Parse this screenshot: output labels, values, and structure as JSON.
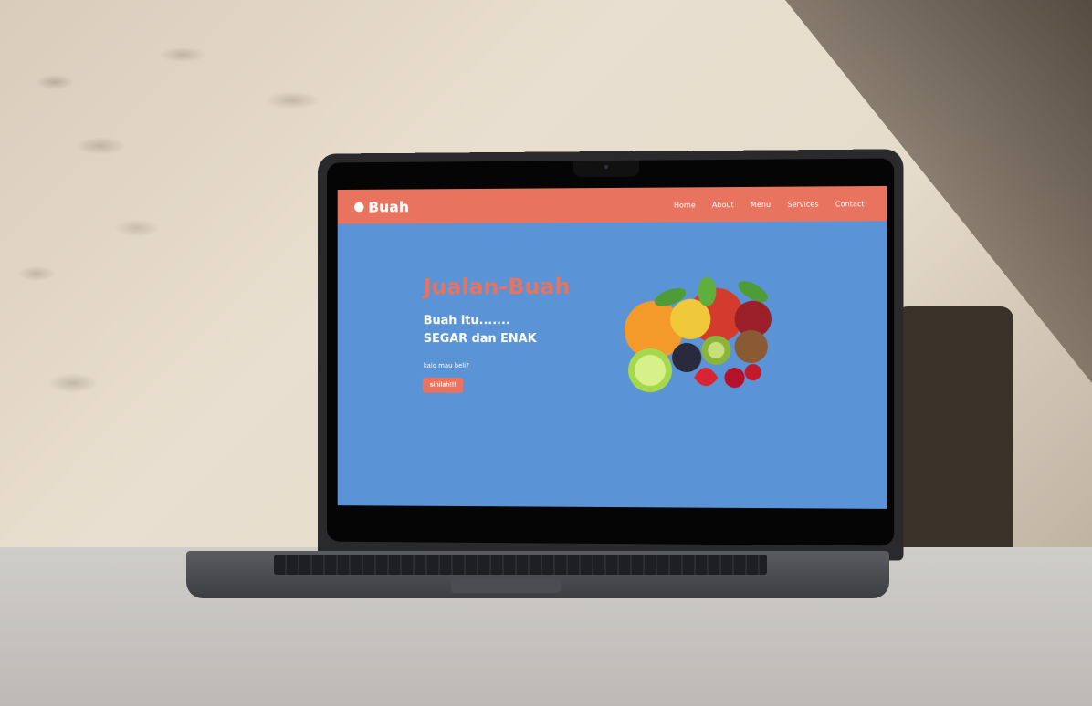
{
  "site": {
    "brand": "Buah",
    "nav": [
      "Home",
      "About",
      "Menu",
      "Services",
      "Contact"
    ]
  },
  "hero": {
    "title": "Jualan-Buah",
    "subtitle_line1": "Buah itu.......",
    "subtitle_line2": "SEGAR dan ENAK",
    "ask": "kalo mau beli?",
    "cta": "sinilah!!!"
  },
  "colors": {
    "navbar": "#e8735e",
    "hero_bg": "#5a94d6",
    "accent": "#e8735e"
  },
  "icons": {
    "brand_icon": "apple-icon",
    "hero_image": "fruit-basket-illustration"
  }
}
